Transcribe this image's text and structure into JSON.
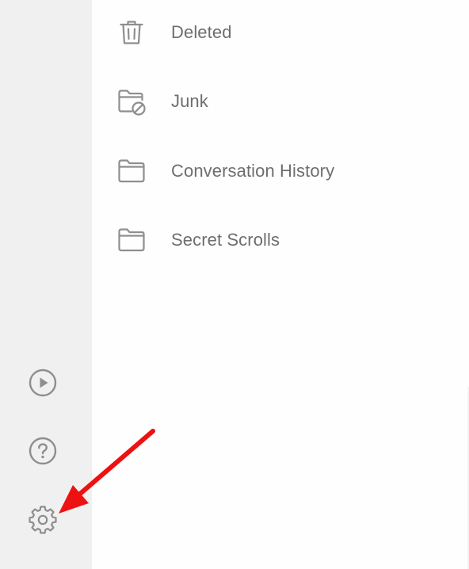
{
  "folders": [
    {
      "label": "Deleted",
      "icon": "trash-icon"
    },
    {
      "label": "Junk",
      "icon": "junk-folder-icon"
    },
    {
      "label": "Conversation History",
      "icon": "folder-icon"
    },
    {
      "label": "Secret Scrolls",
      "icon": "folder-icon"
    }
  ],
  "rail": {
    "items": [
      {
        "icon": "play-icon"
      },
      {
        "icon": "help-icon"
      },
      {
        "icon": "gear-icon"
      }
    ]
  },
  "annotation": {
    "arrow_color": "#ee1111",
    "target": "gear-icon"
  },
  "colors": {
    "sidebar_bg": "#f0f0f0",
    "content_bg": "#fefefe",
    "icon_gray": "#8e8e8e",
    "text_gray": "#6e6e6e"
  }
}
